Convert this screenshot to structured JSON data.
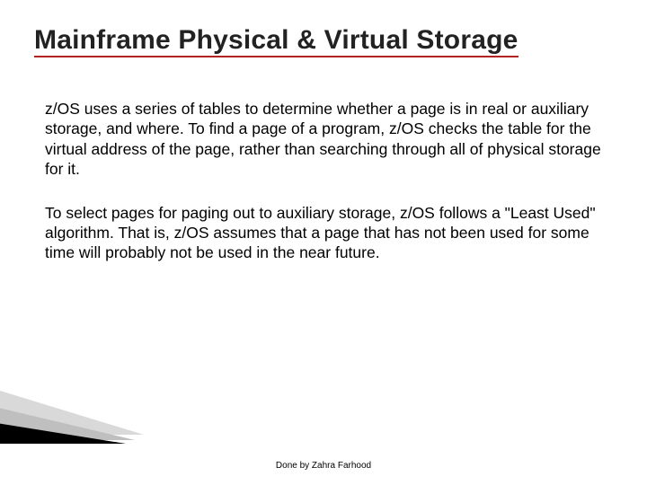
{
  "title": "Mainframe Physical  & Virtual Storage",
  "paragraphs": [
    "z/OS uses a series of tables to determine whether a page is in real or auxiliary storage, and where. To find a page of a program, z/OS checks the table for the virtual address of the page, rather than searching through all of physical storage for it.",
    "To select pages for paging out to auxiliary storage, z/OS follows a \"Least Used\" algorithm. That is, z/OS assumes that a page that has not been used for some time will probably not be used in the near future."
  ],
  "footer": "Done by Zahra Farhood"
}
